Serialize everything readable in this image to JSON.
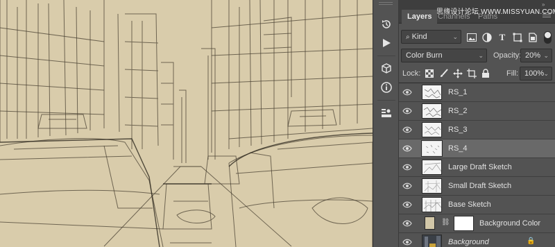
{
  "toolstrip": {
    "icons": [
      "history-icon",
      "play-actions-icon",
      "3d-cube-icon",
      "info-icon",
      "layer-comps-icon"
    ]
  },
  "panel": {
    "tabs": [
      {
        "label": "Layers",
        "active": true
      },
      {
        "label": "Channels",
        "active": false
      },
      {
        "label": "Paths",
        "active": false
      }
    ],
    "watermark": "思缘设计论坛 WWW.MISSYUAN.COM",
    "filter": {
      "kind_label": "Kind",
      "icons": [
        "pixel-filter-icon",
        "adjustment-filter-icon",
        "type-filter-icon",
        "shape-filter-icon",
        "smart-object-filter-icon"
      ]
    },
    "blend": {
      "mode": "Color Burn",
      "opacity_label": "Opacity:",
      "opacity_value": "20%"
    },
    "lock": {
      "label": "Lock:",
      "icons": [
        "lock-transparent-icon",
        "lock-pixels-icon",
        "lock-position-icon",
        "lock-artboard-icon",
        "lock-all-icon"
      ],
      "fill_label": "Fill:",
      "fill_value": "100%"
    },
    "layers": [
      {
        "name": "RS_1",
        "selected": false
      },
      {
        "name": "RS_2",
        "selected": false
      },
      {
        "name": "RS_3",
        "selected": false
      },
      {
        "name": "RS_4",
        "selected": true
      },
      {
        "name": "Large Draft Sketch",
        "selected": false
      },
      {
        "name": "Small Draft Sketch",
        "selected": false
      },
      {
        "name": "Base Sketch",
        "selected": false
      },
      {
        "name": "Background Color",
        "selected": false
      },
      {
        "name": "Background",
        "selected": false
      }
    ]
  },
  "colors": {
    "canvas_bg": "#d8cbaa",
    "sketch_line": "#4a4233",
    "panel_bg": "#535353",
    "selected_row": "#696969",
    "swatch": "#d2c7a8"
  }
}
